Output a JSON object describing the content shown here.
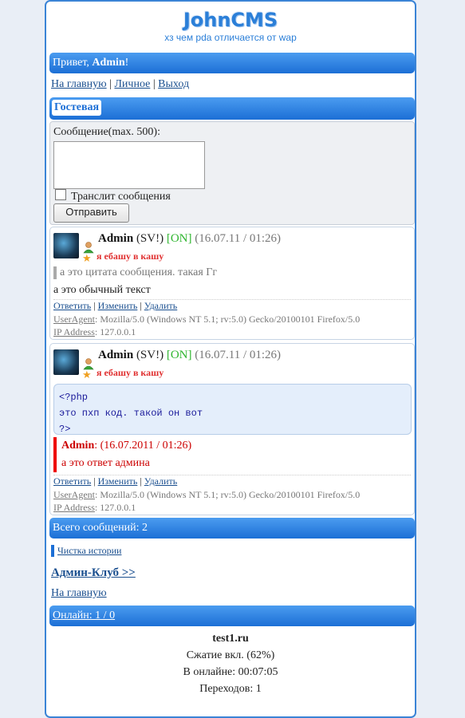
{
  "logo": {
    "title": "JohnCMS",
    "subtitle": "хз чем pda отличается от wap"
  },
  "greeting": {
    "prefix": "Привет, ",
    "user": "Admin",
    "suffix": "!"
  },
  "nav": {
    "home": "На главную",
    "personal": "Личное",
    "logout": "Выход",
    "sep": "|"
  },
  "section_title": "Гостевая",
  "form": {
    "message_label": "Сообщение(max. 500):",
    "translit_label": "Транслит сообщения",
    "send_label": "Отправить"
  },
  "posts": [
    {
      "author": "Admin",
      "role": "(SV!)",
      "online": "[ON]",
      "time": "(16.07.11 / 01:26)",
      "status": "я ебашу в кашу",
      "quote": "а это цитата сообщения. такая Гг",
      "text": "а это обычный текст",
      "actions": [
        "Ответить",
        "Изменить",
        "Удалить"
      ],
      "useragent_label": "UserAgent",
      "useragent": "Mozilla/5.0 (Windows NT 5.1; rv:5.0) Gecko/20100101 Firefox/5.0",
      "ip_label": "IP Address",
      "ip": "127.0.0.1"
    },
    {
      "author": "Admin",
      "role": "(SV!)",
      "online": "[ON]",
      "time": "(16.07.11 / 01:26)",
      "status": "я ебашу в кашу",
      "code": [
        "<?php",
        "это пхп код. такой он вот",
        "?>"
      ],
      "reply_author": "Admin",
      "reply_time": ": (16.07.2011 / 01:26)",
      "reply_text": "а это ответ админа",
      "actions": [
        "Ответить",
        "Изменить",
        "Удалить"
      ],
      "useragent_label": "UserAgent",
      "useragent": "Mozilla/5.0 (Windows NT 5.1; rv:5.0) Gecko/20100101 Firefox/5.0",
      "ip_label": "IP Address",
      "ip": "127.0.0.1"
    }
  ],
  "total": "Всего сообщений: 2",
  "clean_history": "Чистка истории",
  "admin_club": "Админ-Клуб >>",
  "home_link": "На главную",
  "online": "Онлайн: 1 / 0",
  "stats": {
    "site": "test1.ru",
    "compression": "Сжатие вкл. (62%)",
    "online_time": "В онлайне: 00:07:05",
    "transitions": "Переходов: 1"
  }
}
